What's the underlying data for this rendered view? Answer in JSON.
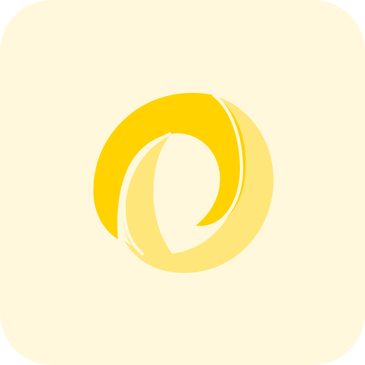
{
  "app_icon": {
    "icon": "jsonld-logo-icon",
    "colors": {
      "tile_background": "#FFF8DC",
      "ring_dark": "#FFD200",
      "ring_light": "#FFE67A",
      "separator": "#FFF8DC"
    }
  }
}
